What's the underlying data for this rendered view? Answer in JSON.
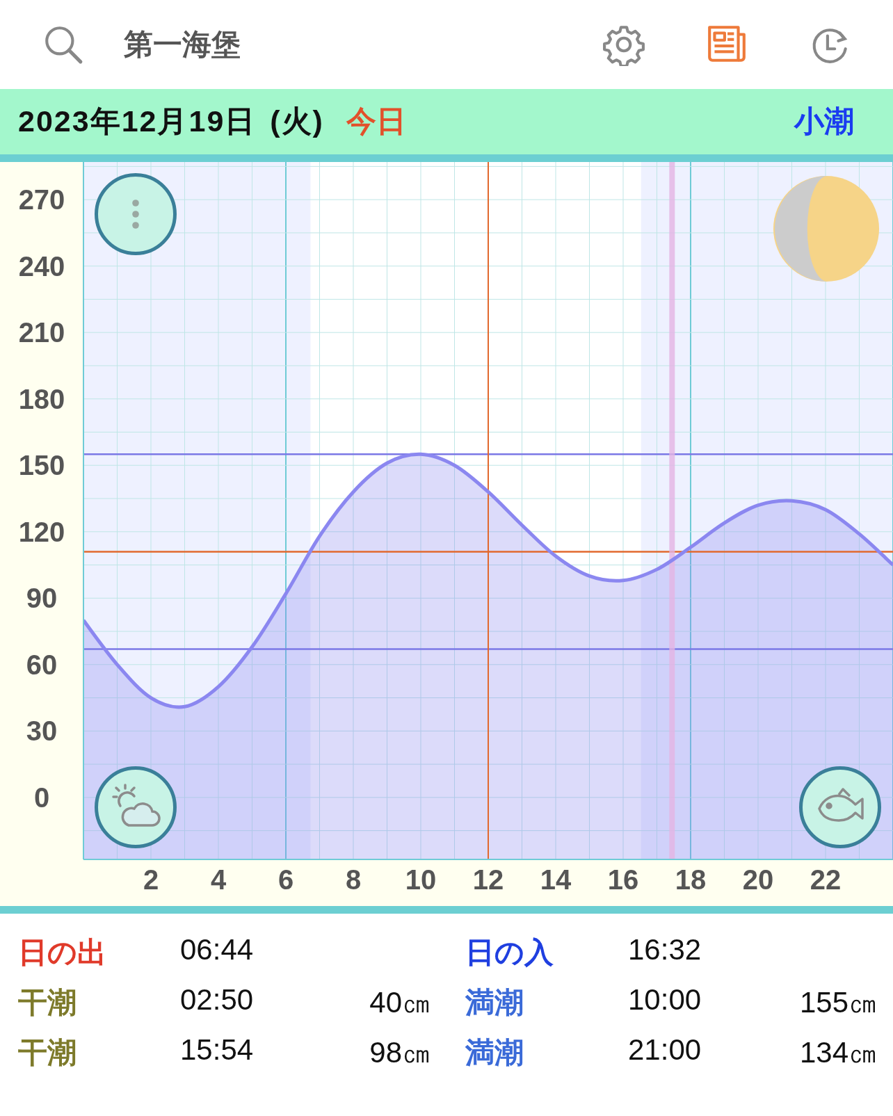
{
  "header": {
    "title": "第一海堡"
  },
  "date_bar": {
    "date": "2023年12月19日 (火)",
    "today_label": "今日",
    "tide_name": "小潮"
  },
  "chart": {
    "chart_data": {
      "type": "area",
      "x": [
        0,
        1,
        2,
        3,
        4,
        5,
        6,
        7,
        8,
        9,
        10,
        11,
        12,
        13,
        14,
        15,
        16,
        17,
        18,
        19,
        20,
        21,
        22,
        23,
        24
      ],
      "series": [
        {
          "color": "#8b87f0",
          "values": [
            80,
            60,
            45,
            41,
            50,
            68,
            92,
            118,
            138,
            151,
            155,
            150,
            138,
            123,
            109,
            100,
            98,
            103,
            113,
            124,
            132,
            134,
            130,
            119,
            105
          ]
        }
      ],
      "xlim": [
        0,
        24
      ],
      "ylim": [
        -28,
        287
      ],
      "xticks": [
        2,
        4,
        6,
        8,
        10,
        12,
        14,
        16,
        18,
        20,
        22
      ],
      "yticks": [
        0,
        30,
        60,
        90,
        120,
        150,
        180,
        210,
        240,
        270
      ],
      "grid": true,
      "bands": [
        {
          "axis": "x",
          "from": 0,
          "to": 6.73,
          "color": "#eef1ff"
        },
        {
          "axis": "x",
          "from": 16.53,
          "to": 24,
          "color": "#eef1ff"
        }
      ],
      "ref_lines": [
        {
          "axis": "y",
          "value": 155,
          "color": "#7b78e6"
        },
        {
          "axis": "y",
          "value": 67,
          "color": "#7b78e6"
        },
        {
          "axis": "y",
          "value": 111,
          "color": "#e2692e"
        },
        {
          "axis": "x",
          "value": 12,
          "color": "#e2692e"
        },
        {
          "axis": "x",
          "value": 17.45,
          "color": "#e4b4e4"
        }
      ]
    }
  },
  "tide_table": [
    {
      "kind": "sunrise",
      "label": "日の出",
      "time": "06:44"
    },
    {
      "kind": "sunset",
      "label": "日の入",
      "time": "16:32"
    },
    {
      "kind": "low",
      "label": "干潮",
      "time": "02:50",
      "height": "40㎝"
    },
    {
      "kind": "high",
      "label": "満潮",
      "time": "10:00",
      "height": "155㎝"
    },
    {
      "kind": "low",
      "label": "干潮",
      "time": "15:54",
      "height": "98㎝"
    },
    {
      "kind": "high",
      "label": "満潮",
      "time": "21:00",
      "height": "134㎝"
    }
  ]
}
